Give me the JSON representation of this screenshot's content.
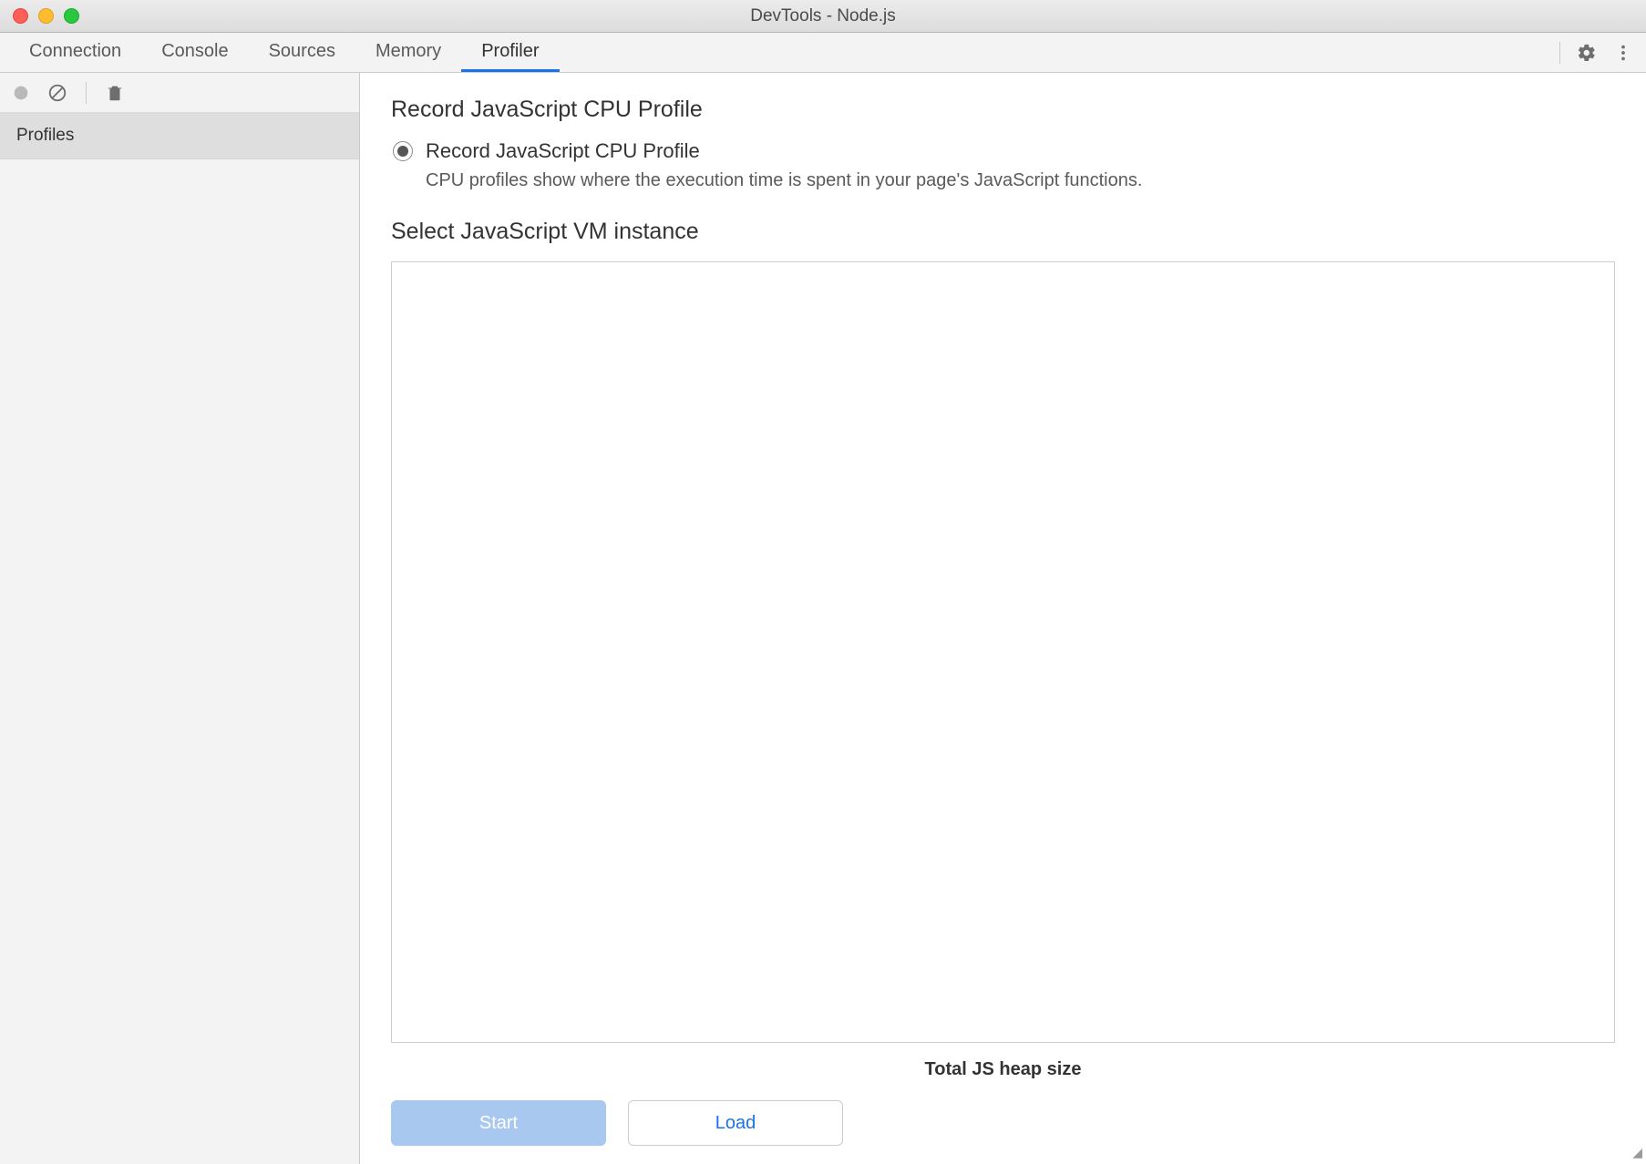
{
  "window": {
    "title": "DevTools - Node.js"
  },
  "tabs": [
    {
      "label": "Connection",
      "active": false
    },
    {
      "label": "Console",
      "active": false
    },
    {
      "label": "Sources",
      "active": false
    },
    {
      "label": "Memory",
      "active": false
    },
    {
      "label": "Profiler",
      "active": true
    }
  ],
  "sidebar": {
    "items": [
      {
        "label": "Profiles"
      }
    ]
  },
  "main": {
    "section_title": "Record JavaScript CPU Profile",
    "radio_label": "Record JavaScript CPU Profile",
    "radio_desc": "CPU profiles show where the execution time is spent in your page's JavaScript functions.",
    "vm_section_title": "Select JavaScript VM instance",
    "heap_label": "Total JS heap size",
    "buttons": {
      "start": "Start",
      "load": "Load"
    }
  }
}
